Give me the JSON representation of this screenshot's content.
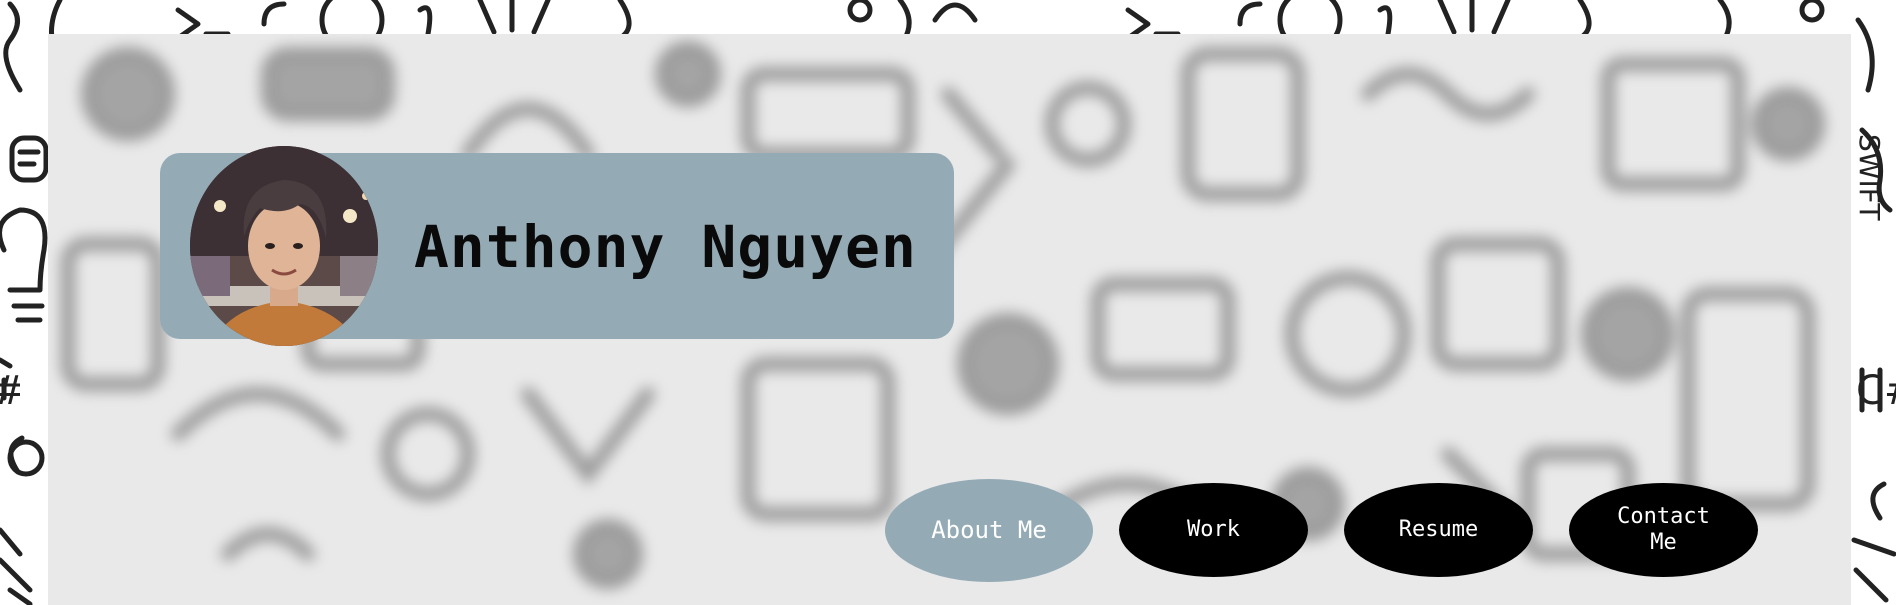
{
  "header": {
    "name": "Anthony Nguyen",
    "avatar_icon": "profile-photo"
  },
  "nav": {
    "items": [
      {
        "label": "About Me",
        "active": true
      },
      {
        "label": "Work",
        "active": false
      },
      {
        "label": "Resume",
        "active": false
      },
      {
        "label": "Contact Me",
        "active": false
      }
    ]
  },
  "colors": {
    "accent": "#94abb6",
    "nav_inactive": "#000000",
    "nav_text": "#ffffff",
    "name_text": "#0a0a0a"
  }
}
